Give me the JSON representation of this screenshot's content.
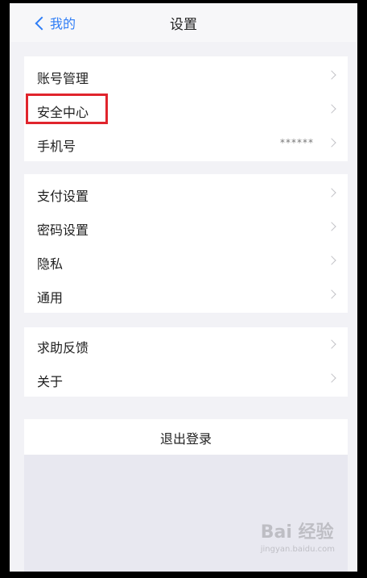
{
  "nav": {
    "back_label": "我的",
    "title": "设置"
  },
  "groups": [
    {
      "items": [
        {
          "label": "账号管理"
        },
        {
          "label": "安全中心"
        },
        {
          "label": "手机号",
          "value": "******"
        }
      ]
    },
    {
      "items": [
        {
          "label": "支付设置"
        },
        {
          "label": "密码设置"
        },
        {
          "label": "隐私"
        },
        {
          "label": "通用"
        }
      ]
    },
    {
      "items": [
        {
          "label": "求助反馈"
        },
        {
          "label": "关于"
        }
      ]
    }
  ],
  "logout_label": "退出登录",
  "watermark": {
    "brand": "Bai 经验",
    "url": "jingyan.baidu.com"
  },
  "colors": {
    "accent": "#2f7df6",
    "highlight": "#e0242c",
    "background": "#f2f2f6"
  }
}
